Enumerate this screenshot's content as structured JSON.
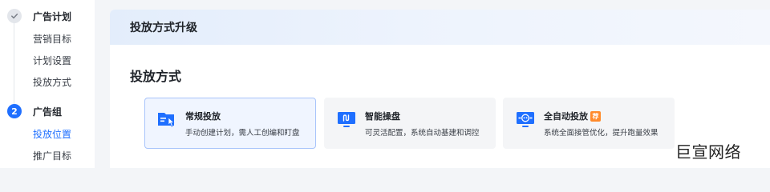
{
  "sidebar": {
    "steps": [
      {
        "marker": "check-icon",
        "title": "广告计划",
        "items": [
          "营销目标",
          "计划设置",
          "投放方式"
        ]
      },
      {
        "marker": "2",
        "title": "广告组",
        "items": [
          "投放位置",
          "推广目标"
        ],
        "active_item": "投放位置"
      }
    ]
  },
  "main": {
    "header_title": "投放方式升级",
    "section_title": "投放方式",
    "cards": [
      {
        "title": "常规投放",
        "desc": "手动创建计划，需人工创编和盯盘",
        "icon": "folder-cursor-icon",
        "selected": true
      },
      {
        "title": "智能操盘",
        "desc": "可灵活配置，系统自动基建和调控",
        "icon": "monitor-wave-icon",
        "selected": false
      },
      {
        "title": "全自动投放",
        "badge": "荐",
        "desc": "系统全面接管优化，提升跑量效果",
        "icon": "monitor-robot-icon",
        "selected": false
      }
    ]
  },
  "watermark": "巨宣网络",
  "colors": {
    "accent": "#1f6fff",
    "badge": "#ff8a2b",
    "selected_border": "#a8c4fb"
  }
}
